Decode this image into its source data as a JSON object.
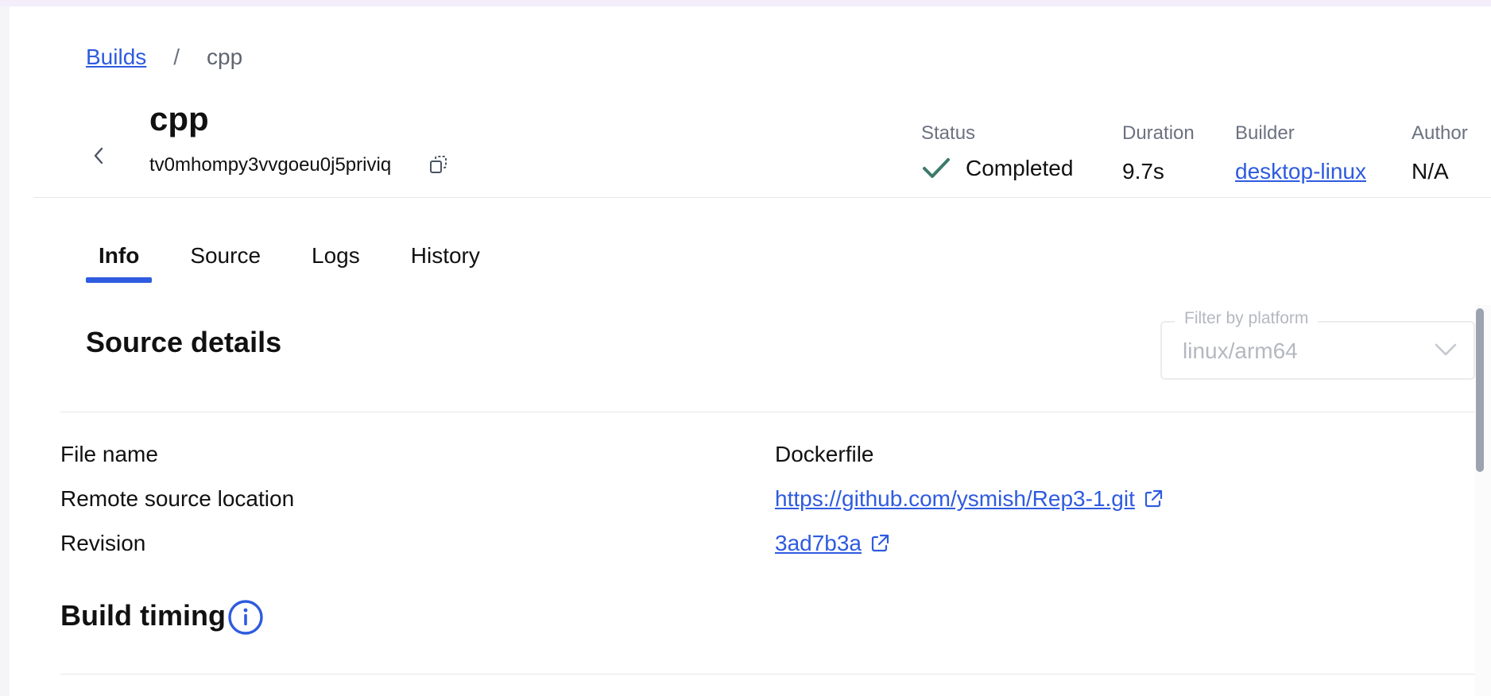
{
  "breadcrumb": {
    "root": "Builds",
    "separator": "/",
    "current": "cpp"
  },
  "build": {
    "name": "cpp",
    "id": "tv0mhompy3vvgoeu0j5priviq"
  },
  "meta": {
    "status_label": "Status",
    "status_value": "Completed",
    "duration_label": "Duration",
    "duration_value": "9.7s",
    "builder_label": "Builder",
    "builder_value": "desktop-linux",
    "author_label": "Author",
    "author_value": "N/A"
  },
  "tabs": [
    "Info",
    "Source",
    "Logs",
    "History"
  ],
  "active_tab": "Info",
  "source_details": {
    "title": "Source details",
    "filter": {
      "legend": "Filter by platform",
      "value": "linux/arm64"
    },
    "rows": [
      {
        "label": "File name",
        "value": "Dockerfile"
      },
      {
        "label": "Remote source location",
        "value": "https://github.com/ysmish/Rep3-1.git"
      },
      {
        "label": "Revision",
        "value": "3ad7b3a"
      }
    ]
  },
  "build_timing": {
    "title": "Build timing"
  },
  "colors": {
    "accent": "#2e5bdf",
    "status_check": "#3d7a6b",
    "muted": "#6b7280"
  }
}
